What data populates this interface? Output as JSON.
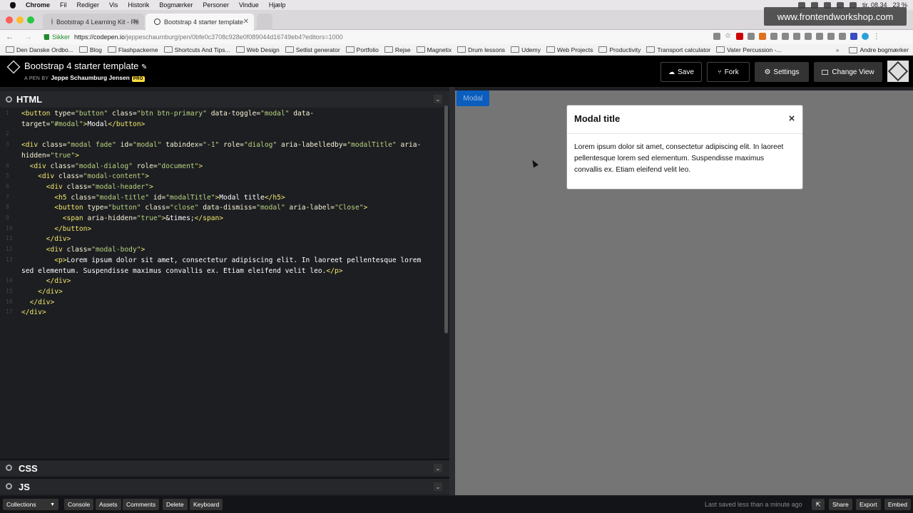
{
  "mac_menu": {
    "apple": "",
    "items": [
      "Chrome",
      "Fil",
      "Rediger",
      "Vis",
      "Historik",
      "Bogmærker",
      "Personer",
      "Vindue",
      "Hjælp"
    ],
    "time": "tir. 08.34",
    "battery": "23 %"
  },
  "watermark": "www.frontendworkshop.com",
  "tabs": [
    {
      "label": "Bootstrap 4 Learning Kit - Re"
    },
    {
      "label": "Bootstrap 4 starter template"
    }
  ],
  "address": {
    "secure": "Sikker",
    "host": "https://codepen.io",
    "path": "/jeppeschaumburg/pen/0bfe0c3708c928e0f089044d16749eb4?editors=1000"
  },
  "bookmarks": [
    "Den Danske Ordbo...",
    "Blog",
    "Flashpackerne",
    "Shortcuts And Tips...",
    "Web Design",
    "Setlist generator",
    "Portfolio",
    "Rejse",
    "Magnetix",
    "Drum lessons",
    "Udemy",
    "Web Projects",
    "Productivity",
    "Transport calculator",
    "Vater Percussion -..."
  ],
  "bookmarks_other": "Andre bogmærker",
  "pen": {
    "title": "Bootstrap 4 starter template",
    "by_prefix": "A PEN BY",
    "author": "Jeppe Schaumburg Jensen",
    "pro": "PRO"
  },
  "header_buttons": {
    "save": "Save",
    "fork": "Fork",
    "settings": "Settings",
    "change_view": "Change View"
  },
  "editor": {
    "html_title": "HTML",
    "css_title": "CSS",
    "js_title": "JS",
    "line_numbers": [
      "1",
      "",
      "2",
      "3",
      "",
      "4",
      "5",
      "6",
      "7",
      "8",
      "9",
      "10",
      "11",
      "12",
      "13",
      "",
      "14",
      "15",
      "16",
      "17"
    ]
  },
  "preview": {
    "modal_button": "Modal",
    "modal_title": "Modal title",
    "close": "×",
    "modal_body": "Lorem ipsum dolor sit amet, consectetur adipiscing elit. In laoreet pellentesque lorem sed elementum. Suspendisse maximus convallis ex. Etiam eleifend velit leo."
  },
  "footer": {
    "collections": "Collections",
    "console": "Console",
    "assets": "Assets",
    "comments": "Comments",
    "delete": "Delete",
    "keyboard": "Keyboard",
    "saved": "Last saved less than a minute ago",
    "share": "Share",
    "export": "Export",
    "embed": "Embed"
  }
}
